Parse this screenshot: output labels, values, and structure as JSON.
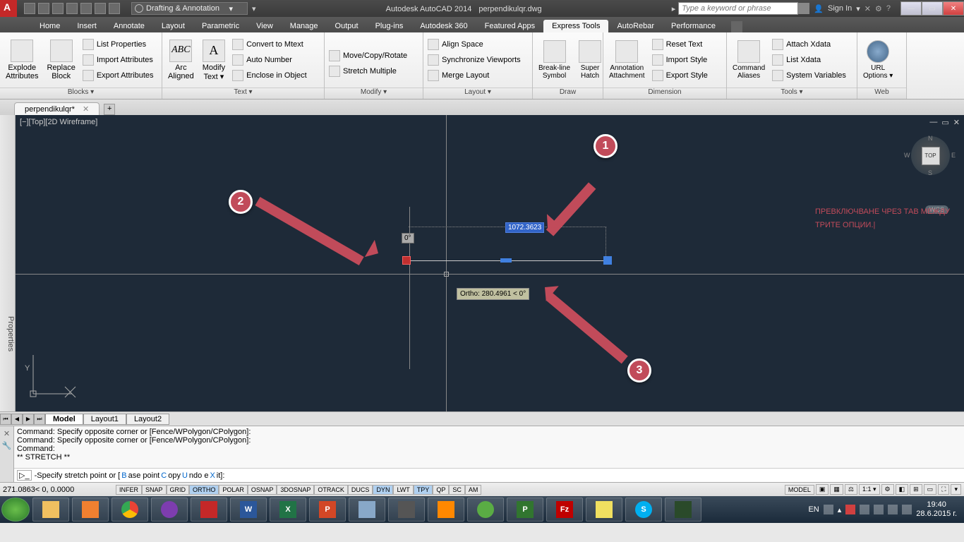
{
  "title": {
    "app": "Autodesk AutoCAD 2014",
    "file": "perpendikulqr.dwg"
  },
  "workspace": "Drafting & Annotation",
  "search_placeholder": "Type a keyword or phrase",
  "signin": "Sign In",
  "menu_tabs": [
    "Home",
    "Insert",
    "Annotate",
    "Layout",
    "Parametric",
    "View",
    "Manage",
    "Output",
    "Plug-ins",
    "Autodesk 360",
    "Featured Apps",
    "Express Tools",
    "AutoRebar",
    "Performance"
  ],
  "active_tab": "Express Tools",
  "panels": {
    "blocks": {
      "title": "Blocks ▾",
      "explode": "Explode\nAttributes",
      "replace": "Replace\nBlock",
      "list": "List Properties",
      "import": "Import Attributes",
      "export": "Export Attributes"
    },
    "text": {
      "title": "Text ▾",
      "arc": "Arc\nAligned",
      "modify": "Modify\nText ▾",
      "mtext": "Convert to Mtext",
      "auto": "Auto Number",
      "enclose": "Enclose in Object"
    },
    "modify": {
      "title": "Modify ▾",
      "move": "Move/Copy/Rotate",
      "stretch": "Stretch Multiple"
    },
    "layout": {
      "title": "Layout ▾",
      "align": "Align Space",
      "sync": "Synchronize Viewports",
      "merge": "Merge Layout"
    },
    "draw": {
      "title": "Draw",
      "break": "Break-line\nSymbol",
      "hatch": "Super\nHatch"
    },
    "dimension": {
      "title": "Dimension",
      "annot": "Annotation\nAttachment",
      "reset": "Reset Text",
      "impstyle": "Import Style",
      "expstyle": "Export Style"
    },
    "tools": {
      "title": "Tools ▾",
      "cmd": "Command\nAliases",
      "xdata": "Attach Xdata",
      "listx": "List Xdata",
      "sysvar": "System Variables"
    },
    "web": {
      "title": "Web",
      "url": "URL\nOptions ▾"
    }
  },
  "doc_tab": "perpendikulqr*",
  "viewport_label": "[−][Top][2D Wireframe]",
  "viewcube_face": "TOP",
  "wcs": "WCS",
  "angle_value": "0°",
  "distance_value": "1072.3623",
  "ortho_value": "Ortho: 280.4961 < 0°",
  "overlay": {
    "line1": "ПРЕВКЛЮЧВАНЕ ЧРЕЗ ТАВ МЕЖДУ",
    "line2": "ТРИТЕ ОПЦИИ.|"
  },
  "callouts": {
    "c1": "1",
    "c2": "2",
    "c3": "3"
  },
  "layout_tabs": [
    "Model",
    "Layout1",
    "Layout2"
  ],
  "cmd_history": {
    "l1": "Command: Specify opposite corner or [Fence/WPolygon/CPolygon]:",
    "l2": "Command: Specify opposite corner or [Fence/WPolygon/CPolygon]:",
    "l3": "Command:",
    "l4": "** STRETCH **"
  },
  "cmd_prompt": {
    "pre": "-Specify stretch point or [",
    "b": "B",
    "ase": "ase point ",
    "c": "C",
    "opy": "opy ",
    "u": "U",
    "ndo": "ndo e",
    "x": "X",
    "it": "it]:"
  },
  "coords": "271.0863<  0, 0.0000",
  "status_toggles": [
    "INFER",
    "SNAP",
    "GRID",
    "ORTHO",
    "POLAR",
    "OSNAP",
    "3DOSNAP",
    "OTRACK",
    "DUCS",
    "DYN",
    "LWT",
    "TPY",
    "QP",
    "SC",
    "AM"
  ],
  "status_on": [
    "ORTHO",
    "DYN",
    "TPY"
  ],
  "status_right": {
    "model": "MODEL",
    "scale": "1:1 ▾"
  },
  "tray": {
    "lang": "EN",
    "time": "19:40",
    "date": "28.6.2015 г."
  }
}
